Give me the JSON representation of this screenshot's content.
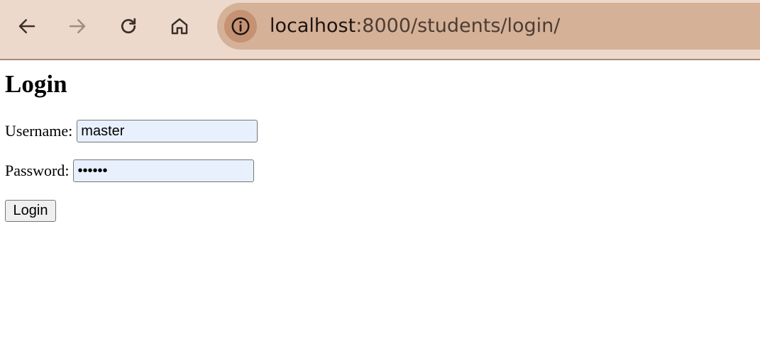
{
  "browser": {
    "url_host": "localhost",
    "url_path": ":8000/students/login/",
    "icons": {
      "back": "back-arrow-icon",
      "forward": "forward-arrow-icon",
      "reload": "reload-icon",
      "home": "home-icon",
      "site_info": "info-icon"
    }
  },
  "page": {
    "title": "Login",
    "username_label": "Username:",
    "username_value": "master",
    "password_label": "Password:",
    "password_value": "••••••",
    "submit_label": "Login"
  },
  "colors": {
    "toolbar_bg": "#ecd9cc",
    "omnibox_bg": "#d5b198",
    "autofill_bg": "#e8f0fe"
  }
}
